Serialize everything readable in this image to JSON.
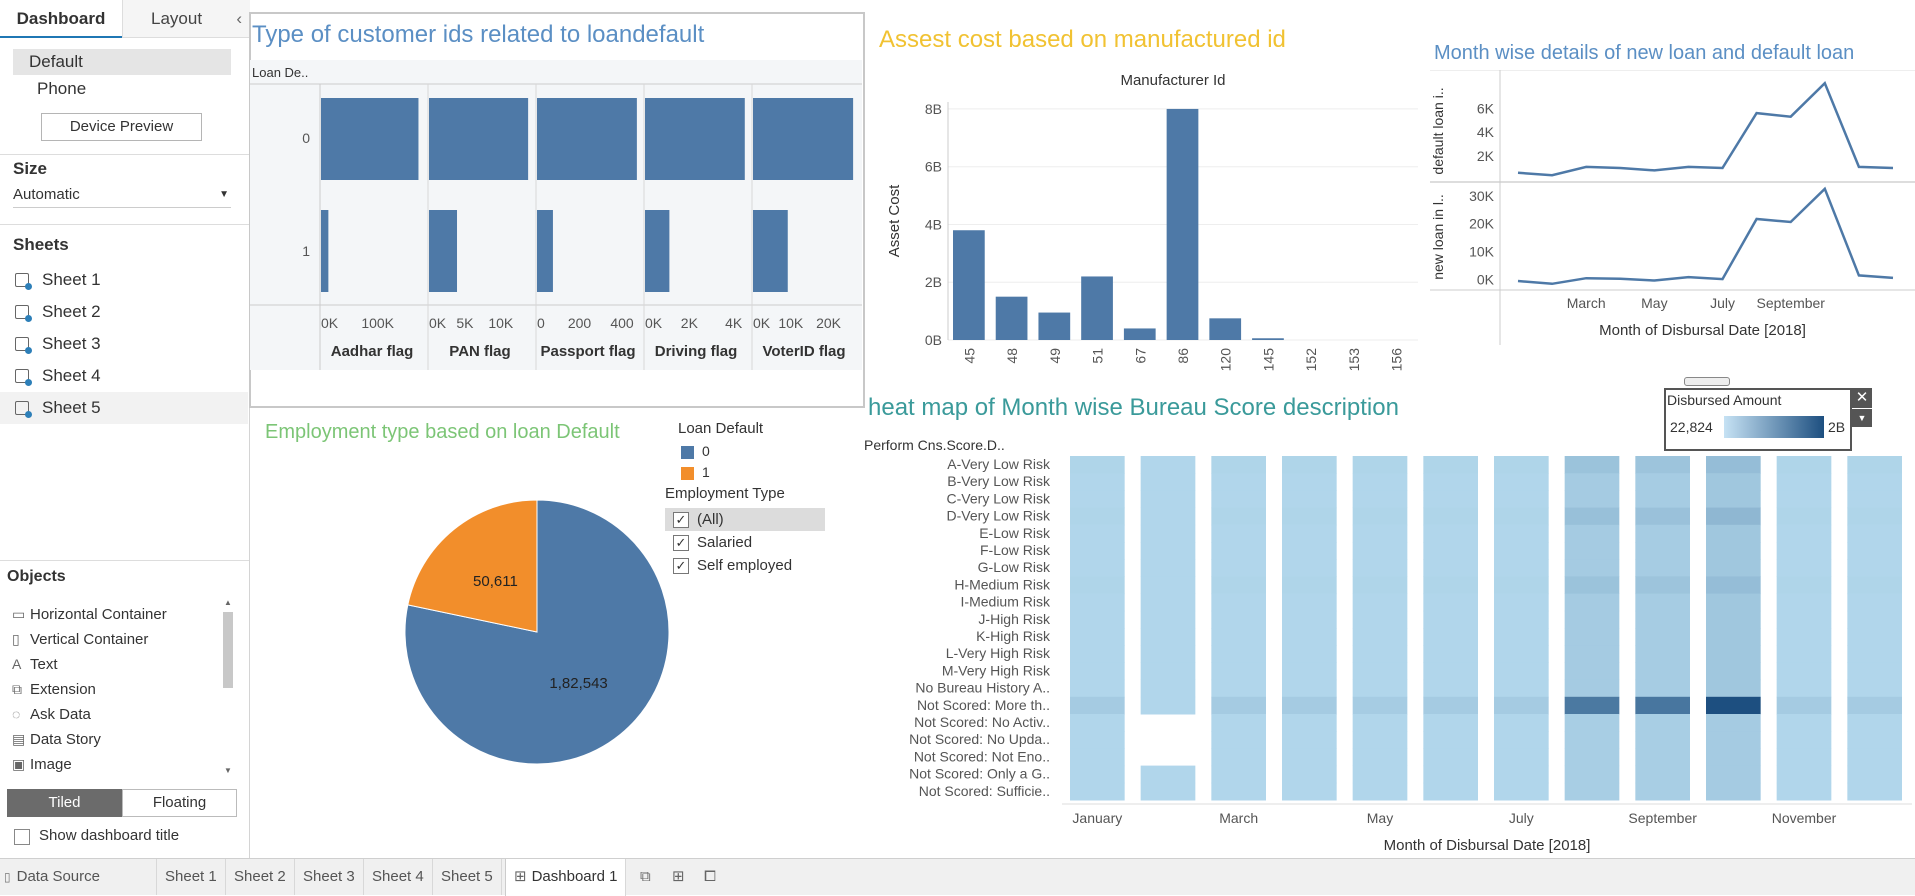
{
  "left": {
    "tab_dashboard": "Dashboard",
    "tab_layout": "Layout",
    "devices": [
      "Default",
      "Phone"
    ],
    "device_preview": "Device Preview",
    "size_title": "Size",
    "size_value": "Automatic",
    "sheets_title": "Sheets",
    "sheets": [
      "Sheet 1",
      "Sheet 2",
      "Sheet 3",
      "Sheet 4",
      "Sheet 5"
    ],
    "objects_title": "Objects",
    "objects": [
      {
        "label": "Horizontal Container",
        "icon": "horizontal-container-icon"
      },
      {
        "label": "Vertical Container",
        "icon": "vertical-container-icon"
      },
      {
        "label": "Text",
        "icon": "text-icon"
      },
      {
        "label": "Extension",
        "icon": "extension-icon"
      },
      {
        "label": "Ask Data",
        "icon": "ask-data-icon"
      },
      {
        "label": "Data Story",
        "icon": "data-story-icon"
      },
      {
        "label": "Image",
        "icon": "image-icon"
      }
    ],
    "tiled": "Tiled",
    "floating": "Floating",
    "show_title": "Show dashboard title"
  },
  "bottom": {
    "data_source": "Data Source",
    "tabs": [
      "Sheet 1",
      "Sheet 2",
      "Sheet 3",
      "Sheet 4",
      "Sheet 5"
    ],
    "dashboard": "Dashboard 1"
  },
  "colors": {
    "blue": "#4e79a7",
    "orange": "#f28e2b",
    "gold": "#f1c232",
    "title_blue": "#5b8fc4",
    "green": "#7cc576",
    "teal": "#3a9a9a"
  },
  "chart_data": [
    {
      "id": "customer-ids",
      "type": "bar",
      "title": "Type of customer ids related to loandefault",
      "row_header": "Loan De..",
      "rows": [
        "0",
        "1"
      ],
      "panels": [
        {
          "name": "Aadhar flag",
          "ticks": [
            "0K",
            "100K"
          ],
          "tick_values": [
            0,
            100000
          ],
          "max": 180000,
          "values": [
            172000,
            13000
          ]
        },
        {
          "name": "PAN flag",
          "ticks": [
            "0K",
            "5K",
            "10K"
          ],
          "tick_values": [
            0,
            5000,
            10000
          ],
          "max": 14200,
          "values": [
            13800,
            3900
          ]
        },
        {
          "name": "Passport flag",
          "ticks": [
            "0",
            "200",
            "400"
          ],
          "tick_values": [
            0,
            200,
            400
          ],
          "max": 480,
          "values": [
            470,
            75
          ]
        },
        {
          "name": "Driving flag",
          "ticks": [
            "0K",
            "2K",
            "4K"
          ],
          "tick_values": [
            0,
            2000,
            4000
          ],
          "max": 4600,
          "values": [
            4500,
            1100
          ]
        },
        {
          "name": "VoterID flag",
          "ticks": [
            "0K",
            "10K",
            "20K"
          ],
          "tick_values": [
            0,
            10000,
            20000
          ],
          "max": 27000,
          "values": [
            26500,
            9200
          ]
        }
      ]
    },
    {
      "id": "asset-cost",
      "type": "bar",
      "title": "Assest cost based on manufactured id",
      "header": "Manufacturer Id",
      "ylabel": "Asset Cost",
      "categories": [
        "45",
        "48",
        "49",
        "51",
        "67",
        "86",
        "120",
        "145",
        "152",
        "153",
        "156"
      ],
      "values": [
        3800000000,
        1500000000,
        950000000,
        2200000000,
        400000000,
        8000000000,
        750000000,
        60000000,
        0,
        0,
        0
      ],
      "yticks": [
        "0B",
        "2B",
        "4B",
        "6B",
        "8B"
      ],
      "ylim": [
        0,
        8000000000
      ]
    },
    {
      "id": "month-loans",
      "type": "line",
      "title": "Month wise details of new loan and default loan",
      "xlabel": "Month of Disbursal Date [2018]",
      "x_ticks": [
        "March",
        "May",
        "July",
        "September"
      ],
      "months": [
        1,
        2,
        3,
        4,
        5,
        6,
        7,
        8,
        9,
        10,
        11,
        12
      ],
      "series": [
        {
          "name": "default loan i..",
          "values": [
            600,
            400,
            1100,
            1000,
            800,
            1100,
            1000,
            5600,
            5300,
            8100,
            1100,
            1000
          ],
          "ticks": [
            "2K",
            "4K",
            "6K"
          ],
          "tick_values": [
            2000,
            4000,
            6000
          ],
          "max": 8200
        },
        {
          "name": "new loan in l..",
          "values": [
            -500,
            -1500,
            500,
            300,
            -300,
            900,
            200,
            21700,
            20600,
            32500,
            1500,
            600
          ],
          "ticks": [
            "0K",
            "10K",
            "20K",
            "30K"
          ],
          "tick_values": [
            0,
            10000,
            20000,
            30000
          ],
          "max": 33500,
          "min": -3000
        }
      ]
    },
    {
      "id": "employment",
      "type": "pie",
      "title": "Employment type based on loan Default",
      "legend_title": "Loan Default",
      "legend": [
        {
          "name": "0",
          "value": 182543,
          "label": "1,82,543"
        },
        {
          "name": "1",
          "value": 50611,
          "label": "50,611"
        }
      ],
      "filter_title": "Employment Type",
      "filter_items": [
        "(All)",
        "Salaried",
        "Self employed"
      ]
    },
    {
      "id": "bureau-heatmap",
      "type": "heatmap",
      "title": "heat map of Month wise Bureau Score description",
      "row_header": "Perform Cns.Score.D..",
      "rows": [
        "A-Very Low Risk",
        "B-Very Low Risk",
        "C-Very Low Risk",
        "D-Very Low Risk",
        "E-Low Risk",
        "F-Low Risk",
        "G-Low Risk",
        "H-Medium Risk",
        "I-Medium Risk",
        "J-High Risk",
        "K-High Risk",
        "L-Very High Risk",
        "M-Very High Risk",
        "No Bureau History A..",
        "Not Scored: More th..",
        "Not Scored: No Activ..",
        "Not Scored: No Upda..",
        "Not Scored: Not Eno..",
        "Not Scored: Only a G..",
        "Not Scored: Sufficie.."
      ],
      "x_ticks": [
        "January",
        "March",
        "May",
        "July",
        "September",
        "November"
      ],
      "xlabel": "Month of Disbursal Date [2018]",
      "legend_title": "Disbursed Amount",
      "legend_min": "22,824",
      "legend_max": "2B",
      "intensity": [
        [
          0.05,
          0.04,
          0.04,
          0.05,
          0.04,
          0.04,
          0.04,
          0.05,
          0.04,
          0.04,
          0.04,
          0.04,
          0.04,
          0.04,
          0.12,
          0.04,
          0.04,
          0.04,
          0.04,
          0.04
        ],
        [
          0.04,
          0.04,
          0.04,
          0.04,
          0.04,
          0.04,
          0.04,
          0.04,
          0.04,
          0.04,
          0.04,
          0.04,
          0.04,
          0.04,
          0.04,
          null,
          null,
          null,
          0.04,
          0.04
        ],
        [
          0.05,
          0.04,
          0.04,
          0.05,
          0.04,
          0.04,
          0.04,
          0.05,
          0.04,
          0.04,
          0.04,
          0.04,
          0.04,
          0.04,
          0.12,
          0.04,
          0.04,
          0.04,
          0.04,
          0.04
        ],
        [
          0.05,
          0.04,
          0.04,
          0.05,
          0.04,
          0.04,
          0.04,
          0.05,
          0.04,
          0.04,
          0.04,
          0.04,
          0.04,
          0.04,
          0.12,
          0.04,
          0.04,
          0.04,
          0.04,
          0.04
        ],
        [
          0.05,
          0.04,
          0.04,
          0.05,
          0.04,
          0.04,
          0.04,
          0.05,
          0.04,
          0.04,
          0.04,
          0.04,
          0.04,
          0.04,
          0.11,
          0.04,
          0.04,
          0.04,
          0.04,
          0.04
        ],
        [
          0.05,
          0.04,
          0.04,
          0.05,
          0.04,
          0.04,
          0.04,
          0.05,
          0.04,
          0.04,
          0.04,
          0.04,
          0.04,
          0.04,
          0.12,
          0.04,
          0.04,
          0.04,
          0.04,
          0.04
        ],
        [
          0.05,
          0.04,
          0.04,
          0.05,
          0.04,
          0.04,
          0.04,
          0.05,
          0.04,
          0.04,
          0.04,
          0.04,
          0.04,
          0.04,
          0.12,
          0.04,
          0.04,
          0.04,
          0.04,
          0.04
        ],
        [
          0.18,
          0.12,
          0.12,
          0.2,
          0.12,
          0.12,
          0.12,
          0.18,
          0.12,
          0.12,
          0.12,
          0.12,
          0.12,
          0.12,
          0.7,
          0.1,
          0.1,
          0.1,
          0.1,
          0.1
        ],
        [
          0.17,
          0.11,
          0.11,
          0.19,
          0.11,
          0.11,
          0.11,
          0.17,
          0.11,
          0.11,
          0.11,
          0.11,
          0.11,
          0.11,
          0.72,
          0.1,
          0.1,
          0.1,
          0.1,
          0.1
        ],
        [
          0.22,
          0.15,
          0.15,
          0.26,
          0.15,
          0.15,
          0.15,
          0.22,
          0.15,
          0.15,
          0.15,
          0.15,
          0.15,
          0.15,
          1.0,
          0.12,
          0.12,
          0.12,
          0.12,
          0.12
        ],
        [
          0.05,
          0.04,
          0.04,
          0.05,
          0.04,
          0.04,
          0.04,
          0.05,
          0.04,
          0.04,
          0.04,
          0.04,
          0.04,
          0.04,
          0.12,
          0.04,
          0.04,
          0.04,
          0.04,
          0.04
        ],
        [
          0.05,
          0.04,
          0.04,
          0.05,
          0.04,
          0.04,
          0.04,
          0.05,
          0.04,
          0.04,
          0.04,
          0.04,
          0.04,
          0.04,
          0.12,
          0.04,
          0.04,
          0.04,
          0.04,
          0.04
        ]
      ]
    }
  ]
}
